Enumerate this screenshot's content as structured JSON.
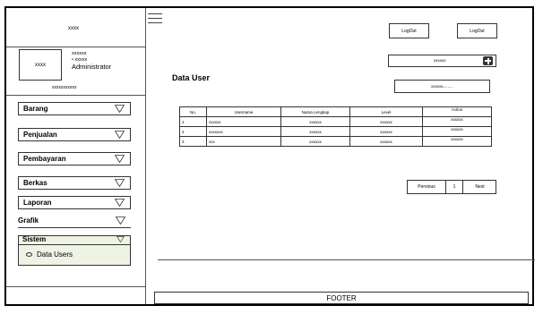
{
  "sidebar": {
    "logo_text": "xxxx",
    "profile": {
      "avatar_text": "xxxx",
      "name": "xxxxxx",
      "bullet_text": "xxxxx",
      "role": "Administrator",
      "footer_text": "xxxxxxxxxxx"
    },
    "menu": [
      {
        "label": "Barang"
      },
      {
        "label": "Penjualan"
      },
      {
        "label": "Pembayaran"
      },
      {
        "label": "Berkas"
      },
      {
        "label": "Laporan"
      },
      {
        "label": "Grafik"
      },
      {
        "label": "Sistem"
      }
    ],
    "submenu": [
      {
        "label": "Data Users"
      }
    ]
  },
  "header": {
    "logout_1": "LogOut",
    "logout_2": "LogOut"
  },
  "main": {
    "title": "Data User",
    "add_field_value": "xxxxxx",
    "search_placeholder": "xxxxxx.........",
    "table": {
      "headers": [
        "No.",
        "Username",
        "Nama Lengkap",
        "Level",
        "Action"
      ],
      "rows": [
        [
          "1",
          "xxxxxx",
          "xxxxxx",
          "xxxxxx",
          "xxxxxx"
        ],
        [
          "2",
          "xxxxxxx",
          "xxxxxx",
          "xxxxxx",
          "xxxxxx"
        ],
        [
          "3",
          "xxx",
          "xxxxxx",
          "xxxxxx",
          "xxxxxx"
        ]
      ]
    },
    "pagination": {
      "previous": "Pervious",
      "page": "1",
      "next": "Next"
    }
  },
  "footer": {
    "label": "FOOTER"
  }
}
